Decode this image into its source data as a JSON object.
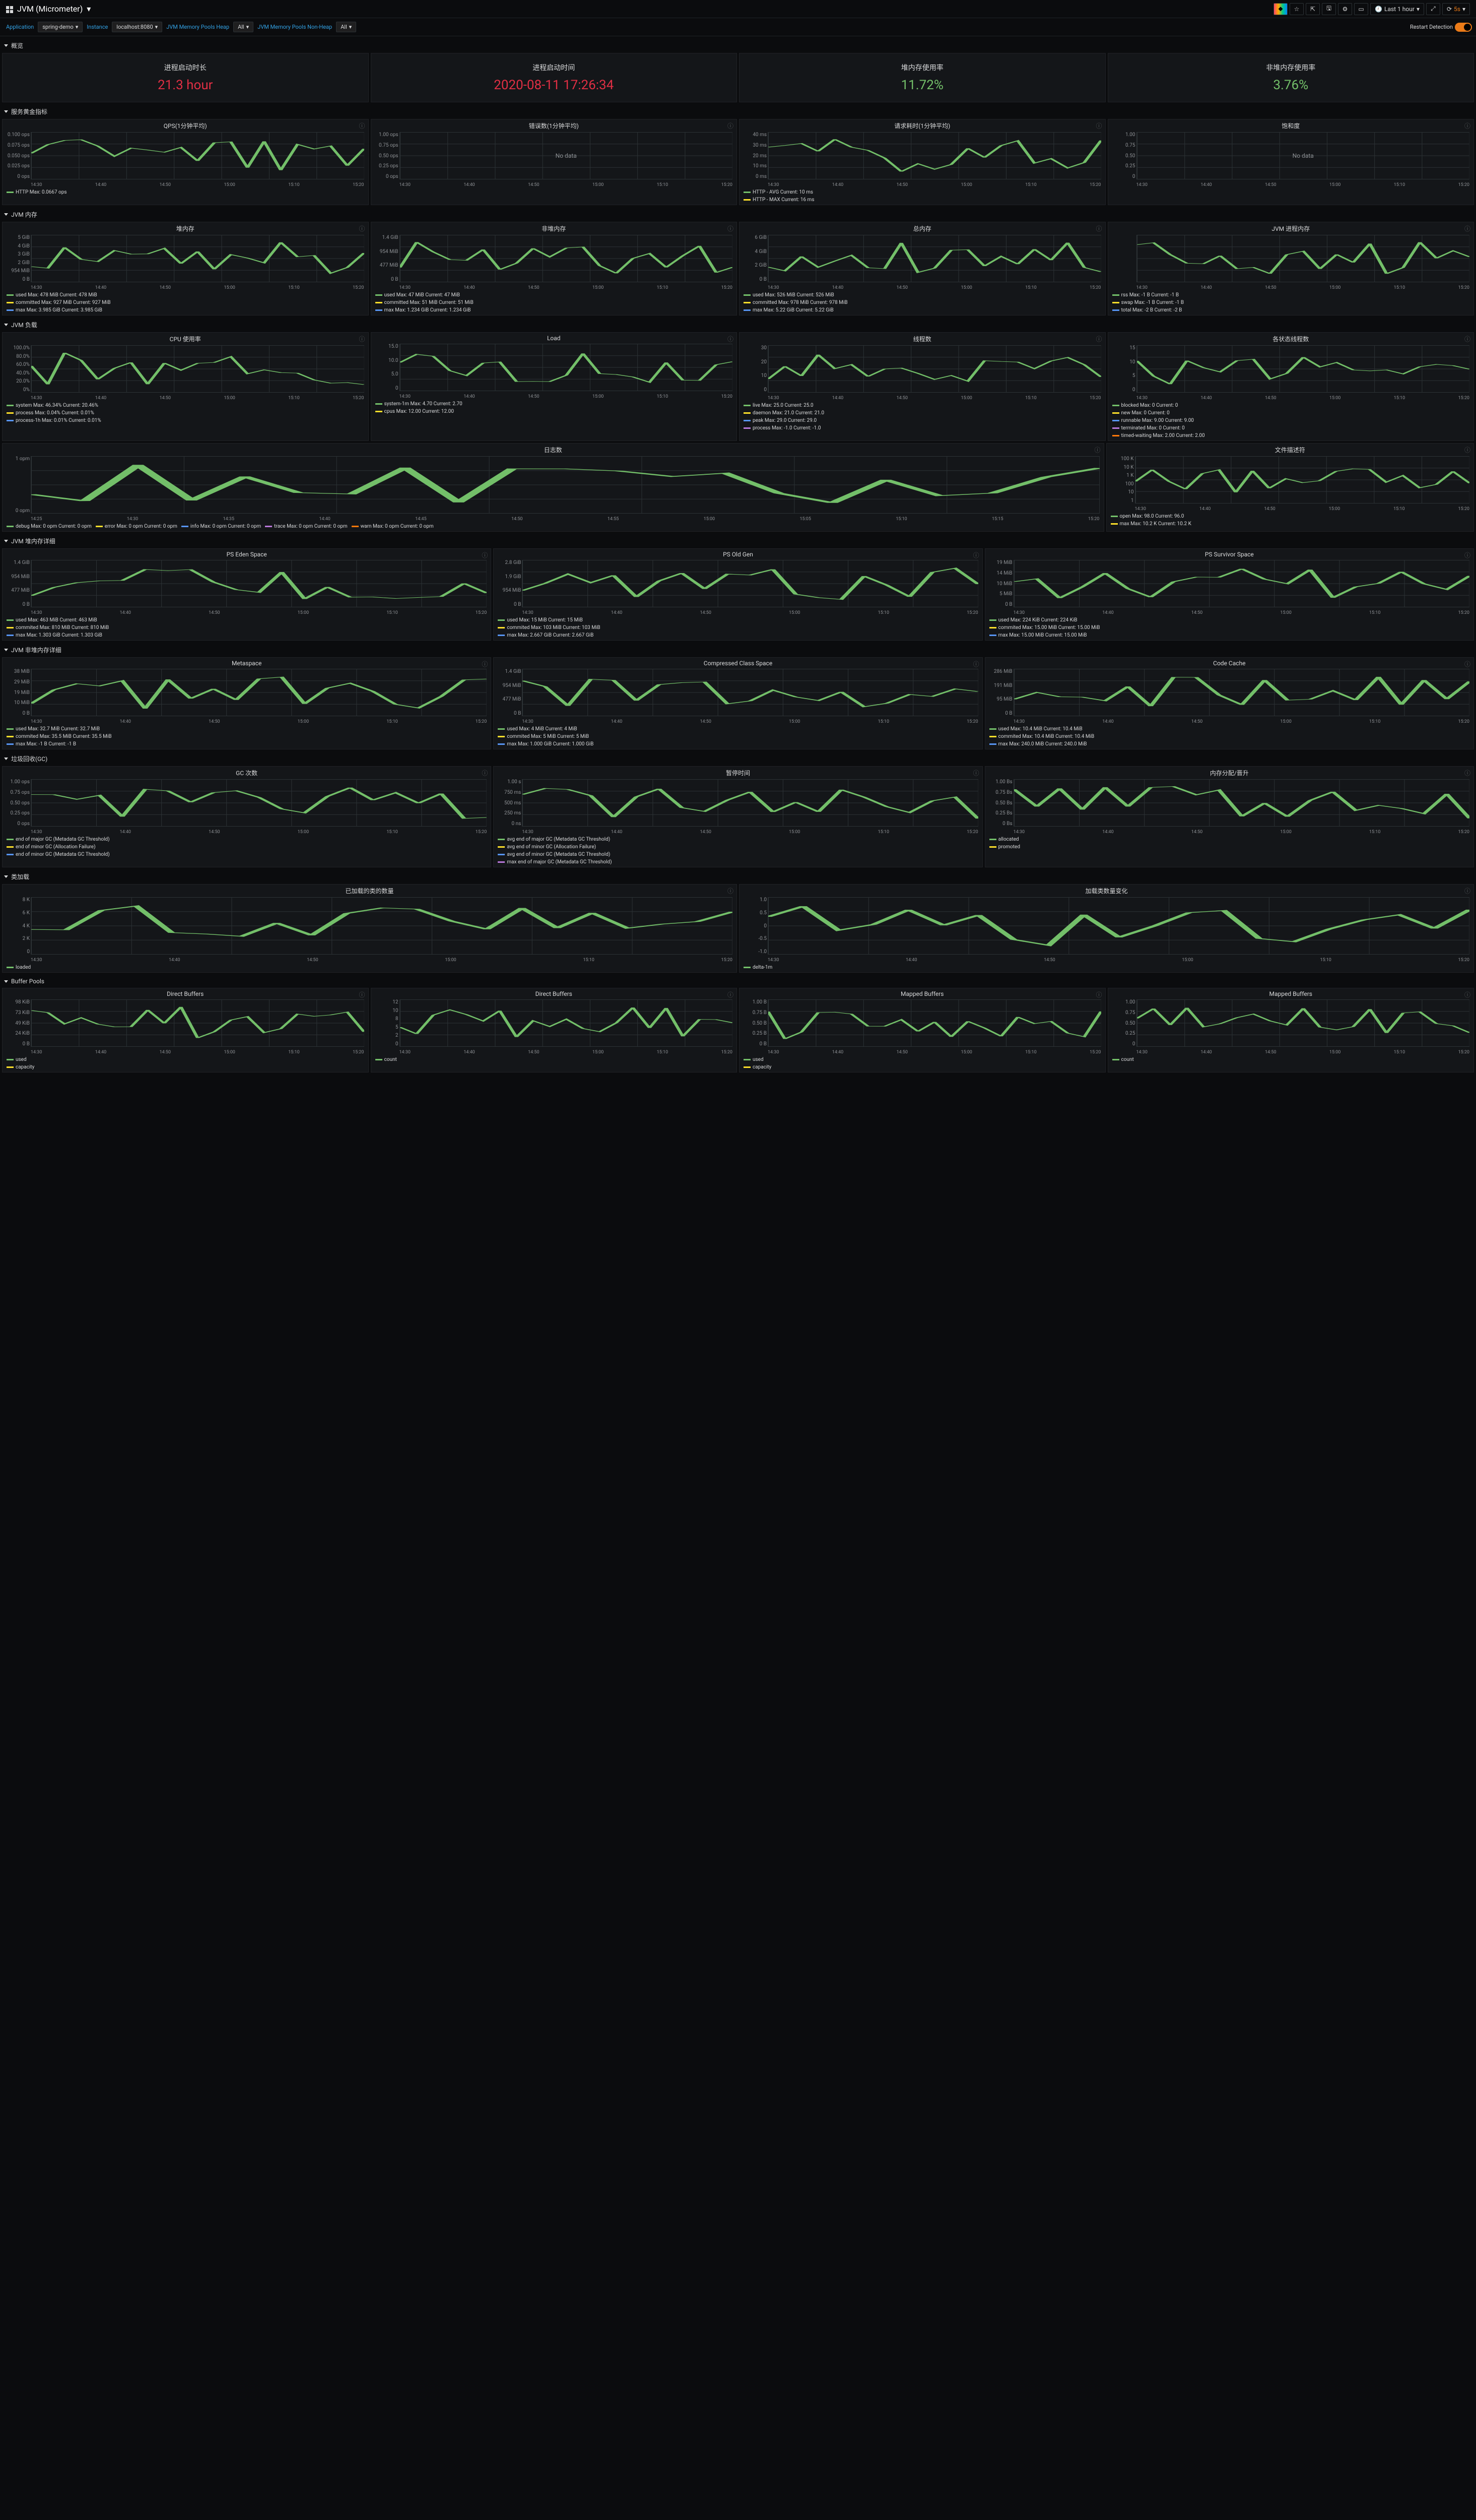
{
  "title": "JVM (Micrometer)",
  "toolbar": {
    "time": "Last 1 hour",
    "refresh": "5s"
  },
  "vars": {
    "app_label": "Application",
    "app_val": "spring-demo",
    "inst_label": "Instance",
    "inst_val": "localhost:8080",
    "heap_label": "JVM Memory Pools Heap",
    "heap_val": "All",
    "nonheap_label": "JVM Memory Pools Non-Heap",
    "nonheap_val": "All",
    "restart": "Restart Detection"
  },
  "sections": {
    "overview": "概览",
    "golden": "服务黄金指标",
    "mem": "JVM 内存",
    "load": "JVM 负载",
    "heapdetail": "JVM 堆内存详细",
    "nonheapdetail": "JVM 非堆内存详细",
    "gc": "垃圾回收(GC)",
    "classload": "类加载",
    "buffer": "Buffer Pools"
  },
  "times": [
    "14:30",
    "14:40",
    "14:50",
    "15:00",
    "15:10",
    "15:20"
  ],
  "stats": {
    "uptime_lbl": "进程启动时长",
    "uptime_val": "21.3 hour",
    "start_lbl": "进程启动时间",
    "start_val": "2020-08-11 17:26:34",
    "heapuse_lbl": "堆内存使用率",
    "heapuse_val": "11.72%",
    "nonheapuse_lbl": "非堆内存使用率",
    "nonheapuse_val": "3.76%"
  },
  "golden": {
    "qps": {
      "title": "QPS(1分钟平均)",
      "ylabels": [
        "0.100 ops",
        "0.075 ops",
        "0.050 ops",
        "0.025 ops",
        "0 ops"
      ],
      "legend": [
        "— HTTP  Max: 0.0667 ops"
      ]
    },
    "err": {
      "title": "错误数(1分钟平均)",
      "ylabels": [
        "1.00 ops",
        "0.75 ops",
        "0.50 ops",
        "0.25 ops",
        "0 ops"
      ],
      "nodata": "No data"
    },
    "latency": {
      "title": "请求耗时(1分钟平均)",
      "ylabels": [
        "40 ms",
        "30 ms",
        "20 ms",
        "10 ms",
        "0 ms"
      ],
      "legend": [
        "— HTTP - AVG  Current: 10 ms",
        "— HTTP - MAX  Current: 16 ms"
      ]
    },
    "sat": {
      "title": "饱和度",
      "ylabels": [
        "1.00",
        "0.75",
        "0.50",
        "0.25",
        "0"
      ],
      "nodata": "No data"
    }
  },
  "mem": {
    "heap": {
      "title": "堆内存",
      "ylabels": [
        "5 GiB",
        "4 GiB",
        "3 GiB",
        "2 GiB",
        "954 MiB",
        "0 B"
      ],
      "legend": [
        "— used  Max: 478 MiB  Current: 478 MiB",
        "— committed  Max: 927 MiB  Current: 927 MiB",
        "— max  Max: 3.985 GiB  Current: 3.985 GiB"
      ]
    },
    "nonheap": {
      "title": "非堆内存",
      "ylabels": [
        "1.4 GiB",
        "954 MiB",
        "477 MiB",
        "0 B"
      ],
      "legend": [
        "— used  Max: 47 MiB  Current: 47 MiB",
        "— committed  Max: 51 MiB  Current: 51 MiB",
        "— max  Max: 1.234 GiB  Current: 1.234 GiB"
      ]
    },
    "total": {
      "title": "总内存",
      "ylabels": [
        "6 GiB",
        "4 GiB",
        "2 GiB",
        "0 B"
      ],
      "legend": [
        "— used  Max: 526 MiB  Current: 526 MiB",
        "— committed  Max: 978 MiB  Current: 978 MiB",
        "— max  Max: 5.22 GiB  Current: 5.22 GiB"
      ]
    },
    "proc": {
      "title": "JVM 进程内存",
      "ylabels": [
        "",
        "",
        "",
        ""
      ],
      "xlabels": [
        "14:30",
        "14:40",
        "14:50",
        "15:00",
        "15:10",
        "15:20"
      ],
      "legend": [
        "— rss  Max: -1 B  Current: -1 B",
        "— swap  Max: -1 B  Current: -1 B",
        "— total  Max: -2 B  Current: -2 B"
      ]
    }
  },
  "load": {
    "cpu": {
      "title": "CPU 使用率",
      "ylabels": [
        "100.0%",
        "80.0%",
        "60.0%",
        "40.0%",
        "20.0%",
        "0%"
      ],
      "legend": [
        "— system  Max: 46.34%  Current: 20.46%",
        "— process  Max: 0.04%  Current: 0.01%",
        "— process-1h  Max: 0.01%  Current: 0.01%"
      ]
    },
    "ld": {
      "title": "Load",
      "ylabels": [
        "15.0",
        "10.0",
        "5.0",
        "0"
      ],
      "legend": [
        "— system-1m  Max: 4.70  Current: 2.70",
        "— cpus  Max: 12.00  Current: 12.00"
      ]
    },
    "threads": {
      "title": "线程数",
      "ylabels": [
        "30",
        "20",
        "10",
        "0"
      ],
      "legend": [
        "— live  Max: 25.0  Current: 25.0",
        "— daemon  Max: 21.0  Current: 21.0",
        "— peak  Max: 29.0  Current: 29.0",
        "— process  Max: -1.0  Current: -1.0"
      ]
    },
    "states": {
      "title": "各状态线程数",
      "ylabels": [
        "15",
        "10",
        "5",
        "0"
      ],
      "legend": [
        "— blocked  Max: 0  Current: 0",
        "— new  Max: 0  Current: 0",
        "— runnable  Max: 9.00  Current: 9.00",
        "— terminated  Max: 0  Current: 0",
        "— timed-waiting  Max: 2.00  Current: 2.00"
      ]
    },
    "logs": {
      "title": "日志数",
      "ylabels": [
        "1 opm",
        "0 opm"
      ],
      "xlabels": [
        "14:25",
        "14:30",
        "14:35",
        "14:40",
        "14:45",
        "14:50",
        "14:55",
        "15:00",
        "15:05",
        "15:10",
        "15:15",
        "15:20"
      ],
      "legend": [
        "— debug  Max: 0 opm  Current: 0 opm",
        "— error  Max: 0 opm  Current: 0 opm",
        "— info  Max: 0 opm  Current: 0 opm",
        "— trace  Max: 0 opm  Current: 0 opm",
        "— warn  Max: 0 opm  Current: 0 opm"
      ]
    },
    "fds": {
      "title": "文件描述符",
      "ylabels": [
        "100 K",
        "10 K",
        "1 K",
        "100",
        "10",
        "1"
      ],
      "legend": [
        "— open  Max: 98.0  Current: 96.0",
        "— max  Max: 10.2 K  Current: 10.2 K"
      ]
    }
  },
  "heapd": {
    "eden": {
      "title": "PS Eden Space",
      "ylabels": [
        "1.4 GiB",
        "954 MiB",
        "477 MiB",
        "0 B"
      ],
      "legend": [
        "— used  Max: 463 MiB  Current: 463 MiB",
        "— commited  Max: 810 MiB  Current: 810 MiB",
        "— max  Max: 1.303 GiB  Current: 1.303 GiB"
      ]
    },
    "old": {
      "title": "PS Old Gen",
      "ylabels": [
        "2.8 GiB",
        "1.9 GiB",
        "954 MiB",
        "0 B"
      ],
      "legend": [
        "— used  Max: 15 MiB  Current: 15 MiB",
        "— commited  Max: 103 MiB  Current: 103 MiB",
        "— max  Max: 2.667 GiB  Current: 2.667 GiB"
      ]
    },
    "surv": {
      "title": "PS Survivor Space",
      "ylabels": [
        "19 MiB",
        "14 MiB",
        "10 MiB",
        "5 MiB",
        "0 B"
      ],
      "legend": [
        "— used  Max: 224 KiB  Current: 224 KiB",
        "— commited  Max: 15.00 MiB  Current: 15.00 MiB",
        "— max  Max: 15.00 MiB  Current: 15.00 MiB"
      ]
    }
  },
  "nonheapd": {
    "meta": {
      "title": "Metaspace",
      "ylabels": [
        "38 MiB",
        "29 MiB",
        "19 MiB",
        "10 MiB",
        "0 B"
      ],
      "legend": [
        "— used  Max: 32.7 MiB  Current: 32.7 MiB",
        "— commited  Max: 35.5 MiB  Current: 35.5 MiB",
        "— max  Max: -1 B  Current: -1 B"
      ]
    },
    "ccs": {
      "title": "Compressed Class Space",
      "ylabels": [
        "1.4 GiB",
        "954 MiB",
        "477 MiB",
        "0 B"
      ],
      "legend": [
        "— used  Max: 4 MiB  Current: 4 MiB",
        "— commited  Max: 5 MiB  Current: 5 MiB",
        "— max  Max: 1.000 GiB  Current: 1.000 GiB"
      ]
    },
    "code": {
      "title": "Code Cache",
      "ylabels": [
        "286 MiB",
        "191 MiB",
        "95 MiB",
        "0 B"
      ],
      "legend": [
        "— used  Max: 10.4 MiB  Current: 10.4 MiB",
        "— commited  Max: 10.4 MiB  Current: 10.4 MiB",
        "— max  Max: 240.0 MiB  Current: 240.0 MiB"
      ]
    }
  },
  "gc": {
    "count": {
      "title": "GC 次数",
      "ylabels": [
        "1.00 ops",
        "0.75 ops",
        "0.50 ops",
        "0.25 ops",
        "0 ops"
      ],
      "legend": [
        "— end of major GC (Metadata GC Threshold)",
        "— end of minor GC (Allocation Failure)",
        "— end of minor GC (Metadata GC Threshold)"
      ]
    },
    "pause": {
      "title": "暂停时间",
      "ylabels": [
        "1.00 s",
        "750 ms",
        "500 ms",
        "250 ms",
        "0 ns"
      ],
      "legend": [
        "— avg end of major GC (Metadata GC Threshold)",
        "— avg end of minor GC (Allocation Failure)",
        "— avg end of minor GC (Metadata GC Threshold)",
        "— max end of major GC (Metadata GC Threshold)"
      ]
    },
    "alloc": {
      "title": "内存分配/晋升",
      "ylabels": [
        "1.00 Bs",
        "0.75 Bs",
        "0.50 Bs",
        "0.25 Bs",
        "0 Bs"
      ],
      "legend": [
        "— allocated",
        "— promoted"
      ]
    }
  },
  "cls": {
    "loaded": {
      "title": "已加载的类的数量",
      "ylabels": [
        "8 K",
        "6 K",
        "4 K",
        "2 K",
        "0"
      ],
      "xlabels": [
        "14:30",
        "14:40",
        "14:50",
        "15:00",
        "15:10",
        "15:20"
      ],
      "legend": [
        "— loaded"
      ]
    },
    "delta": {
      "title": "加载类数量变化",
      "ylabels": [
        "1.0",
        "0.5",
        "0",
        "-0.5",
        "-1.0"
      ],
      "legend": [
        "— delta-1m"
      ]
    }
  },
  "buf": {
    "db1": {
      "title": "Direct Buffers",
      "ylabels": [
        "98 KiB",
        "73 KiB",
        "49 KiB",
        "24 KiB",
        "0 B"
      ],
      "legend": [
        "— used",
        "— capacity"
      ]
    },
    "db2": {
      "title": "Direct Buffers",
      "ylabels": [
        "12",
        "10",
        "8",
        "5",
        "2",
        "0"
      ],
      "legend": [
        "— count"
      ]
    },
    "mb1": {
      "title": "Mapped Buffers",
      "ylabels": [
        "1.00 B",
        "0.75 B",
        "0.50 B",
        "0.25 B",
        "0 B"
      ],
      "legend": [
        "— used",
        "— capacity"
      ]
    },
    "mb2": {
      "title": "Mapped Buffers",
      "ylabels": [
        "1.00",
        "0.75",
        "0.50",
        "0.25",
        "0"
      ],
      "legend": [
        "— count"
      ]
    }
  }
}
